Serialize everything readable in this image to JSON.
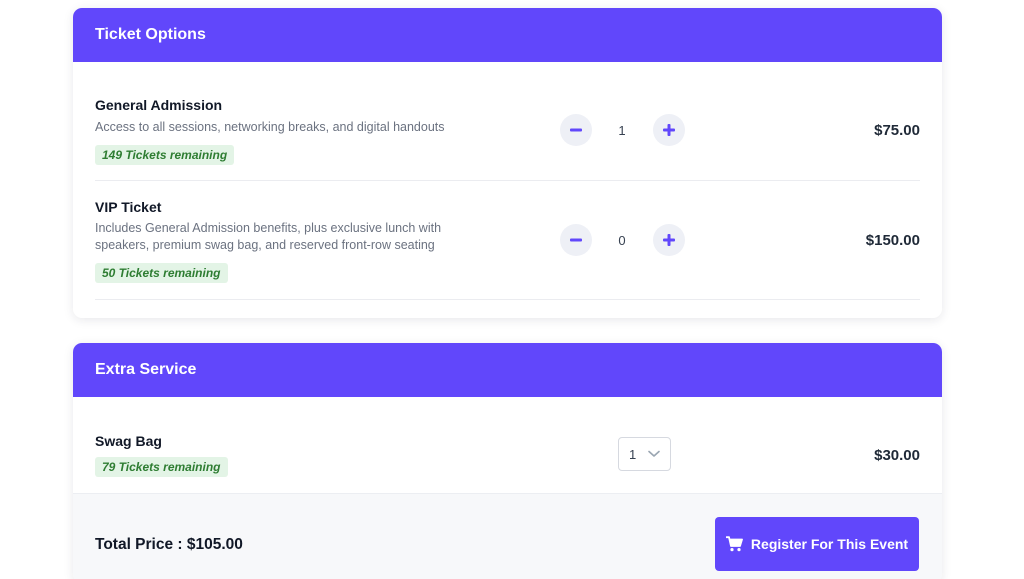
{
  "ticket_options": {
    "header": "Ticket Options",
    "items": [
      {
        "title": "General Admission",
        "description": "Access to all sessions, networking breaks, and digital handouts",
        "remaining": "149 Tickets remaining",
        "quantity": "1",
        "price": "$75.00"
      },
      {
        "title": "VIP Ticket",
        "description": "Includes General Admission benefits, plus exclusive lunch with speakers, premium swag bag, and reserved front-row seating",
        "remaining": "50 Tickets remaining",
        "quantity": "0",
        "price": "$150.00"
      }
    ]
  },
  "extra_service": {
    "header": "Extra Service",
    "items": [
      {
        "title": "Swag Bag",
        "remaining": "79 Tickets remaining",
        "selected_quantity": "1",
        "price": "$30.00"
      }
    ]
  },
  "footer": {
    "total_label": "Total Price : $105.00",
    "register_label": "Register For This Event"
  },
  "icons": {
    "minus": "minus-icon",
    "plus": "plus-icon",
    "chevron": "chevron-down-icon",
    "cart": "cart-icon"
  },
  "colors": {
    "accent": "#6147fb",
    "badge_bg": "#e3f4e6",
    "badge_text": "#2e7d32"
  }
}
